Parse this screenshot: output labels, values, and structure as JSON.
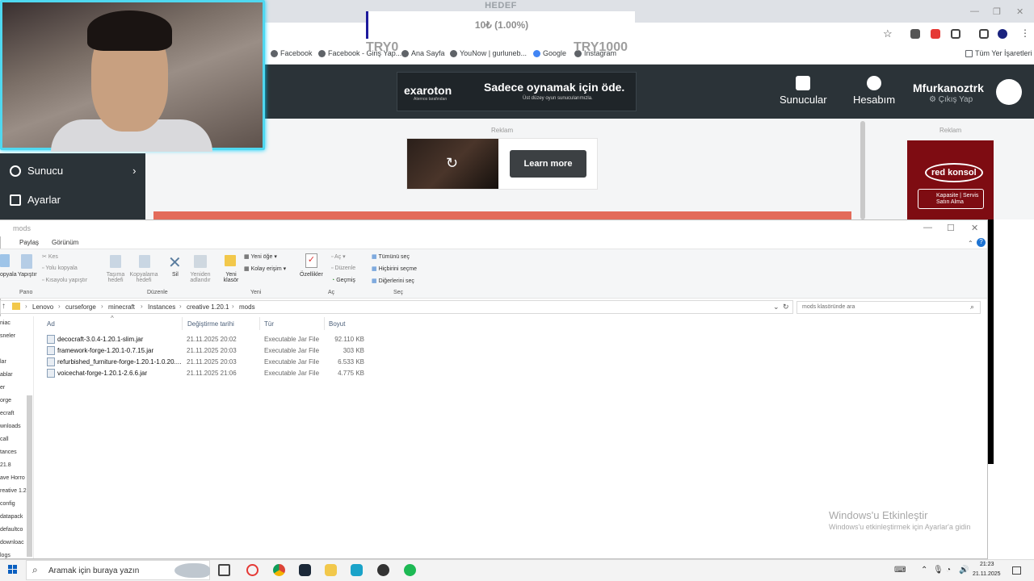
{
  "overlay": {
    "goal_title": "HEDEF",
    "goal_value": "10₺ (1.00%)",
    "goal_min": "TRY0",
    "goal_max": "TRY1000"
  },
  "browser": {
    "bookmarks": [
      "Facebook",
      "Facebook - Giriş Yap...",
      "Ana Sayfa",
      "YouNow | gurluneb...",
      "Google",
      "Instagram"
    ],
    "all_bookmarks": "Tüm Yer İşaretleri"
  },
  "site": {
    "banner_logo": "exaroton",
    "banner_sub": "Aternos tarafından",
    "banner_headline": "Sadece oynamak için öde.",
    "banner_tagline": "Üst düzey oyun sunucularımızla.",
    "nav": [
      {
        "label": "Sunucular"
      },
      {
        "label": "Hesabım"
      }
    ],
    "username": "Mfurkanoztrk",
    "logout": "Çıkış Yap",
    "sidebar": [
      {
        "label": "Sunucu"
      },
      {
        "label": "Ayarlar"
      }
    ],
    "ad_label": "Reklam",
    "ad_button": "Learn more",
    "right_ad_logo": "red konsol",
    "right_ad_button": "Kapasite | Servis Satın Alma"
  },
  "explorer": {
    "title": "mods",
    "tabs": [
      "Paylaş",
      "Görünüm"
    ],
    "ribbon": {
      "cut": "Kes",
      "copy_path": "Yolu kopyala",
      "paste_shortcut": "Kısayolu yapıştır",
      "copy": "opyala",
      "paste": "Yapıştır",
      "move_to": "Taşıma hedefi",
      "copy_to": "Kopyalama hedefi",
      "delete": "Sil",
      "rename": "Yeniden adlandır",
      "new_folder": "Yeni klasör",
      "new_item": "Yeni öğe",
      "easy_access": "Kolay erişim",
      "properties": "Özellikler",
      "open": "Aç",
      "edit": "Düzenle",
      "history": "Geçmiş",
      "select_all": "Tümünü seç",
      "select_none": "Hiçbirini seçme",
      "invert": "Diğerlerini seç",
      "groups": [
        "Pano",
        "Düzenle",
        "Yeni",
        "Aç",
        "Seç"
      ]
    },
    "breadcrumb": [
      "Lenovo",
      "curseforge",
      "minecraft",
      "Instances",
      "creative 1.20.1",
      "mods"
    ],
    "search_placeholder": "mods klasöründe ara",
    "nav_pane": [
      "niac",
      "sneler",
      "lar",
      "ablar",
      "er",
      "orge",
      "ecraft",
      "wnloads",
      "call",
      "tances",
      "21.8",
      "ave Horro",
      "reative 1.2",
      "config",
      "datapack",
      "defaultco",
      "downloac",
      "logs"
    ],
    "columns": [
      "Ad",
      "Değiştirme tarihi",
      "Tür",
      "Boyut"
    ],
    "files": [
      {
        "name": "decocraft-3.0.4-1.20.1-slim.jar",
        "date": "21.11.2025 20:02",
        "type": "Executable Jar File",
        "size": "92.110 KB"
      },
      {
        "name": "framework-forge-1.20.1-0.7.15.jar",
        "date": "21.11.2025 20:03",
        "type": "Executable Jar File",
        "size": "303 KB"
      },
      {
        "name": "refurbished_furniture-forge-1.20.1-1.0.20....",
        "date": "21.11.2025 20:03",
        "type": "Executable Jar File",
        "size": "6.533 KB"
      },
      {
        "name": "voicechat-forge-1.20.1-2.6.6.jar",
        "date": "21.11.2025 21:06",
        "type": "Executable Jar File",
        "size": "4.775 KB"
      }
    ]
  },
  "watermark": {
    "line1": "Windows'u Etkinleştir",
    "line2": "Windows'u etkinleştirmek için Ayarlar'a gidin"
  },
  "taskbar": {
    "search_placeholder": "Aramak için buraya yazın",
    "time": "21:23",
    "date": "21.11.2025"
  }
}
